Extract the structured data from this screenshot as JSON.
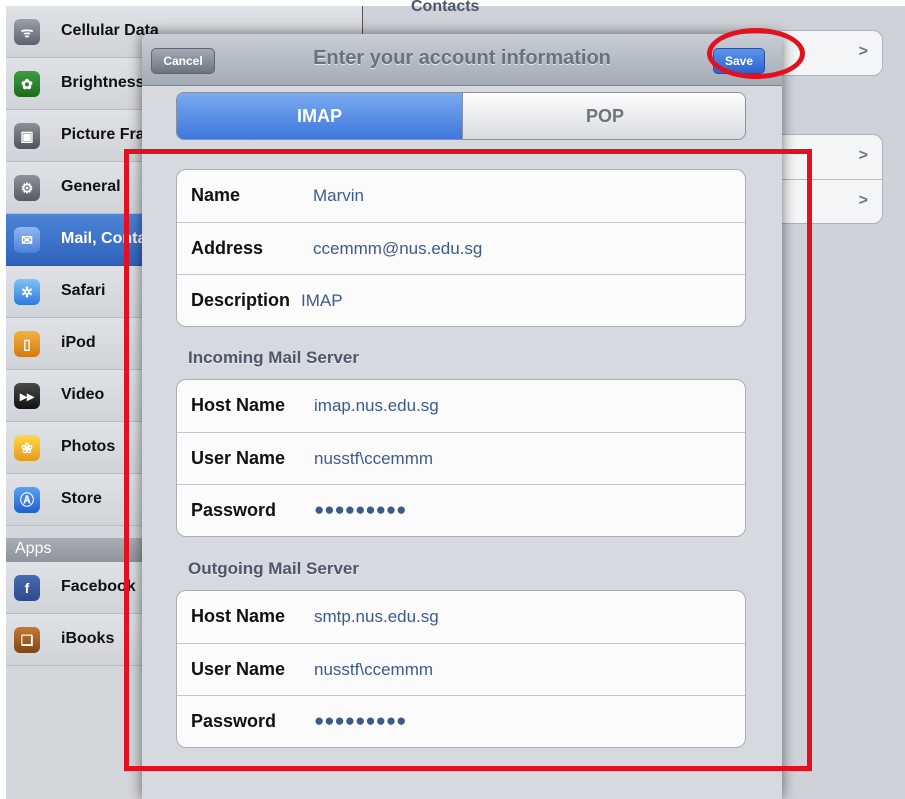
{
  "sidebar": {
    "items": [
      {
        "label": "Cellular Data",
        "icon": "cellular-icon"
      },
      {
        "label": "Brightness",
        "icon": "brightness-icon"
      },
      {
        "label": "Picture Frame",
        "icon": "picture-frame-icon"
      },
      {
        "label": "General",
        "icon": "gear-icon"
      },
      {
        "label": "Mail, Contacts",
        "icon": "mail-icon"
      },
      {
        "label": "Safari",
        "icon": "safari-icon"
      },
      {
        "label": "iPod",
        "icon": "ipod-icon"
      },
      {
        "label": "Video",
        "icon": "video-icon"
      },
      {
        "label": "Photos",
        "icon": "photos-icon"
      },
      {
        "label": "Store",
        "icon": "store-icon"
      }
    ],
    "apps_section": "Apps",
    "apps": [
      {
        "label": "Facebook",
        "icon": "facebook-icon"
      },
      {
        "label": "iBooks",
        "icon": "ibooks-icon"
      }
    ]
  },
  "right_pane": {
    "heading": "Contacts"
  },
  "modal": {
    "title": "Enter your account information",
    "cancel_label": "Cancel",
    "save_label": "Save",
    "segments": [
      {
        "label": "IMAP",
        "selected": true
      },
      {
        "label": "POP",
        "selected": false
      }
    ],
    "account": {
      "name_label": "Name",
      "name_value": "Marvin",
      "address_label": "Address",
      "address_value": "ccemmm@nus.edu.sg",
      "description_label": "Description",
      "description_value": "IMAP"
    },
    "incoming": {
      "header": "Incoming Mail Server",
      "host_label": "Host Name",
      "host_value": "imap.nus.edu.sg",
      "user_label": "User Name",
      "user_value": "nusstf\\ccemmm",
      "password_label": "Password",
      "password_value": "●●●●●●●●●"
    },
    "outgoing": {
      "header": "Outgoing Mail Server",
      "host_label": "Host Name",
      "host_value": "smtp.nus.edu.sg",
      "user_label": "User Name",
      "user_value": "nusstf\\ccemmm",
      "password_label": "Password",
      "password_value": "●●●●●●●●●"
    }
  },
  "colors": {
    "annotation_red": "#e3101f",
    "accent_blue": "#3f77dc",
    "value_blue": "#3d5a8c"
  }
}
